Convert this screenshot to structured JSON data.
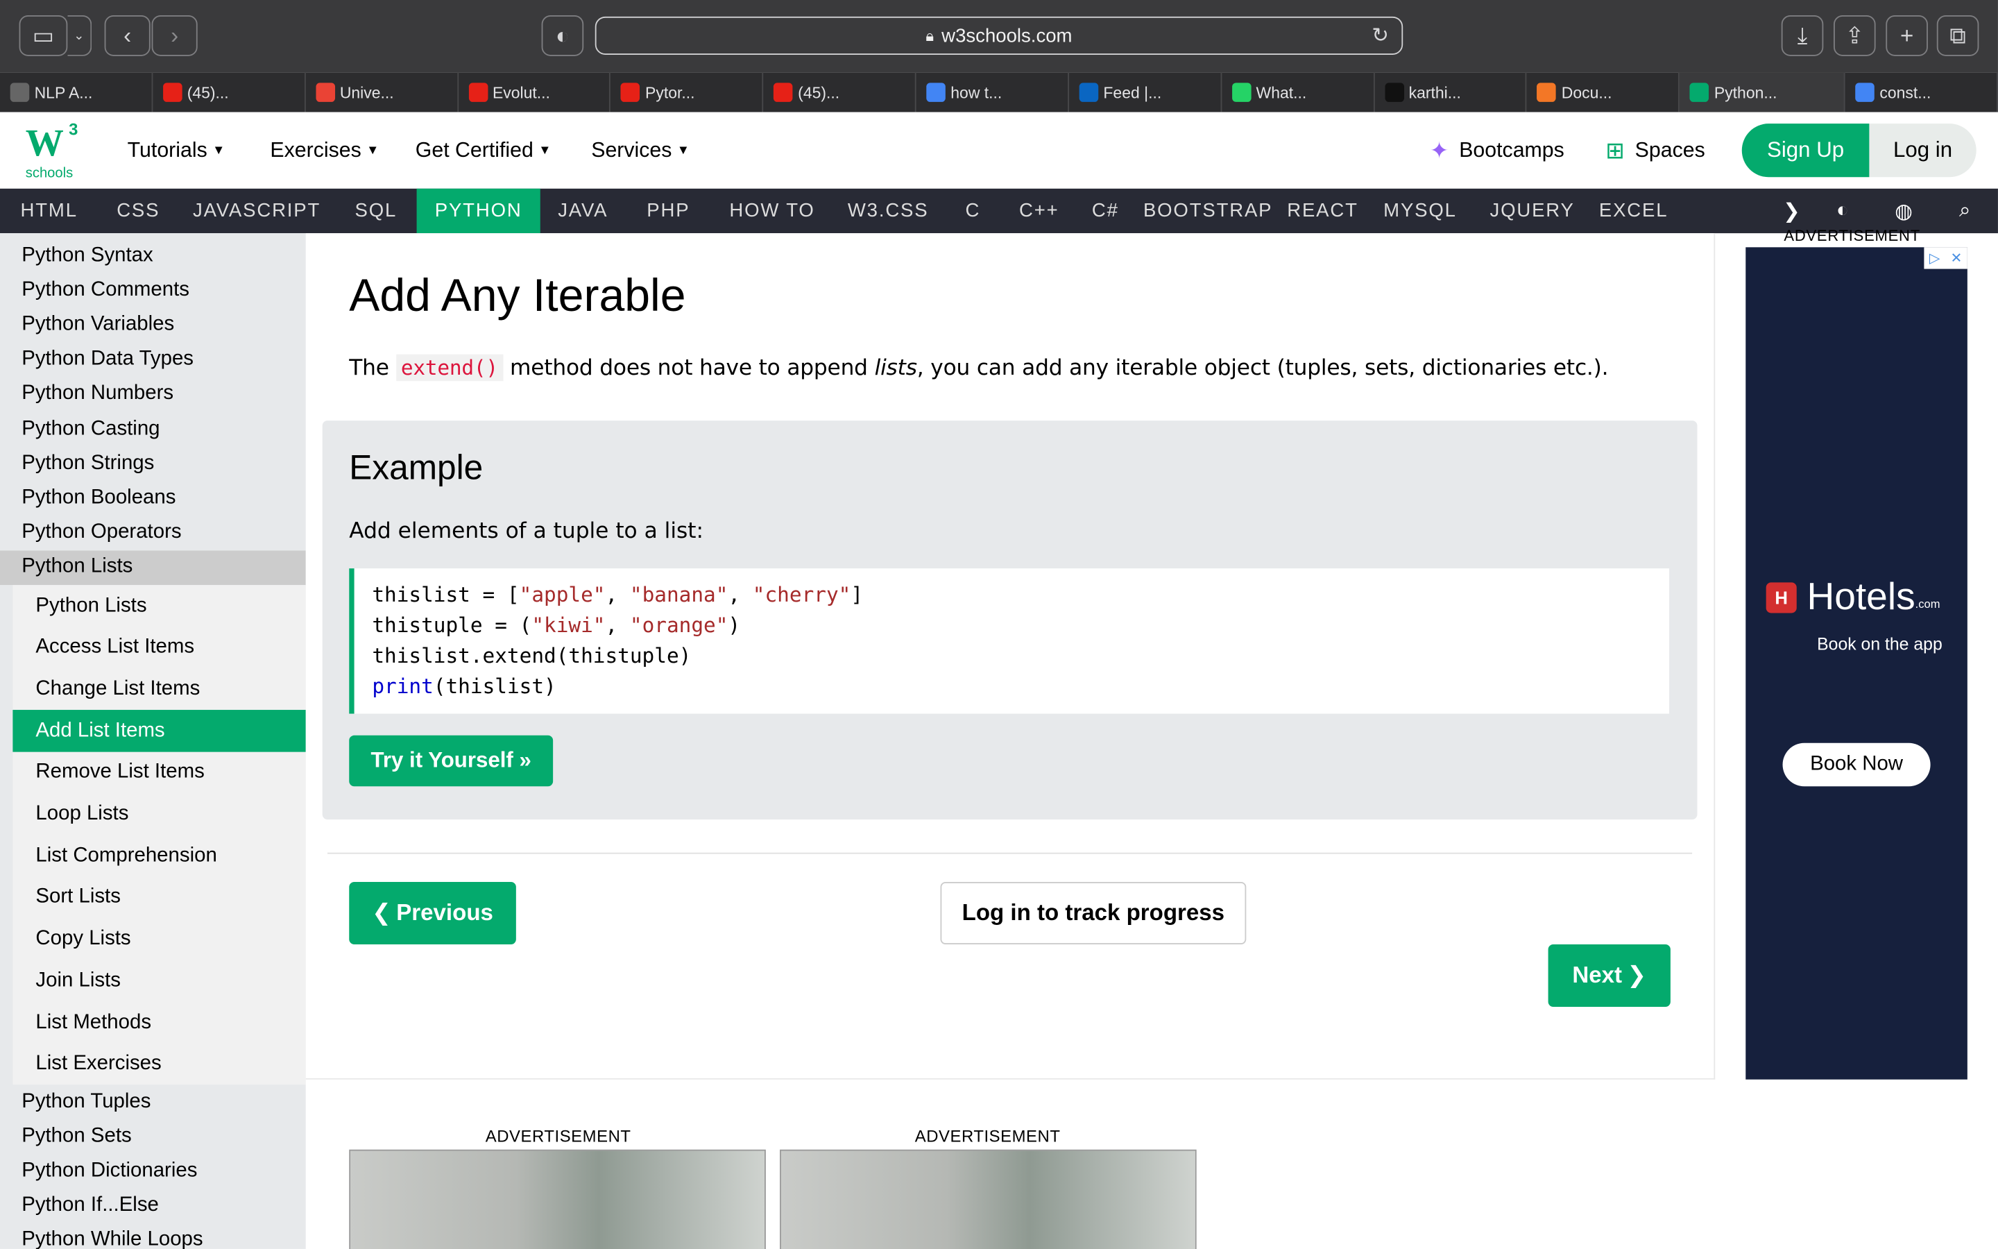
{
  "browser": {
    "url": "w3schools.com",
    "tabs": [
      {
        "label": "NLP A...",
        "icon": "openai-icon",
        "color": "#666"
      },
      {
        "label": "(45)...",
        "icon": "youtube-icon",
        "color": "#e62117"
      },
      {
        "label": "Unive...",
        "icon": "gmail-icon",
        "color": "#ea4335"
      },
      {
        "label": "Evolut...",
        "icon": "youtube-icon",
        "color": "#e62117"
      },
      {
        "label": "Pytor...",
        "icon": "youtube-icon",
        "color": "#e62117"
      },
      {
        "label": "(45)...",
        "icon": "youtube-icon",
        "color": "#e62117"
      },
      {
        "label": "how t...",
        "icon": "google-icon",
        "color": "#4285f4"
      },
      {
        "label": "Feed |...",
        "icon": "linkedin-icon",
        "color": "#0a66c2"
      },
      {
        "label": "What...",
        "icon": "whatsapp-icon",
        "color": "#25d366"
      },
      {
        "label": "karthi...",
        "icon": "github-icon",
        "color": "#111"
      },
      {
        "label": "Docu...",
        "icon": "jupyter-icon",
        "color": "#f37726"
      },
      {
        "label": "Python...",
        "icon": "w3schools-icon",
        "color": "#04aa6d"
      },
      {
        "label": "const...",
        "icon": "google-icon",
        "color": "#4285f4"
      }
    ]
  },
  "header": {
    "logo_sup": "3",
    "logo_text": "schools",
    "menus": [
      "Tutorials",
      "Exercises",
      "Get Certified",
      "Services"
    ],
    "bootcamps": "Bootcamps",
    "spaces": "Spaces",
    "signup": "Sign Up",
    "login": "Log in"
  },
  "subnav": [
    "HTML",
    "CSS",
    "JAVASCRIPT",
    "SQL",
    "PYTHON",
    "JAVA",
    "PHP",
    "HOW TO",
    "W3.CSS",
    "C",
    "C++",
    "C#",
    "BOOTSTRAP",
    "REACT",
    "MYSQL",
    "JQUERY",
    "EXCEL"
  ],
  "subnav_active": "PYTHON",
  "sidebar": {
    "top_links": [
      "Python Syntax",
      "Python Comments",
      "Python Variables",
      "Python Data Types",
      "Python Numbers",
      "Python Casting",
      "Python Strings",
      "Python Booleans",
      "Python Operators",
      "Python Lists"
    ],
    "sub_links": [
      "Python Lists",
      "Access List Items",
      "Change List Items",
      "Add List Items",
      "Remove List Items",
      "Loop Lists",
      "List Comprehension",
      "Sort Lists",
      "Copy Lists",
      "Join Lists",
      "List Methods",
      "List Exercises"
    ],
    "active_sub": "Add List Items",
    "bottom_links": [
      "Python Tuples",
      "Python Sets",
      "Python Dictionaries",
      "Python If...Else",
      "Python While Loops"
    ]
  },
  "main": {
    "title": "Add Any Iterable",
    "intro_before": "The ",
    "intro_code": "extend()",
    "intro_middle": " method does not have to append ",
    "intro_em": "lists",
    "intro_after": ", you can add any iterable object (tuples, sets, dictionaries etc.).",
    "example_heading": "Example",
    "example_desc": "Add elements of a tuple to a list:",
    "code_lines": [
      "thislist = [\"apple\", \"banana\", \"cherry\"]",
      "thistuple = (\"kiwi\", \"orange\")",
      "thislist.extend(thistuple)",
      "print(thislist)"
    ],
    "try_button": "Try it Yourself »",
    "prev_button": "Previous",
    "track_button": "Log in to track progress",
    "next_button": "Next",
    "ad_label": "ADVERTISEMENT"
  },
  "ad": {
    "label": "ADVERTISEMENT",
    "brand": "Hotels",
    "brand_suffix": ".com",
    "tagline": "Book on the app",
    "cta": "Book Now"
  },
  "colors": {
    "accent": "#04aa6d",
    "navbar": "#282a35"
  }
}
